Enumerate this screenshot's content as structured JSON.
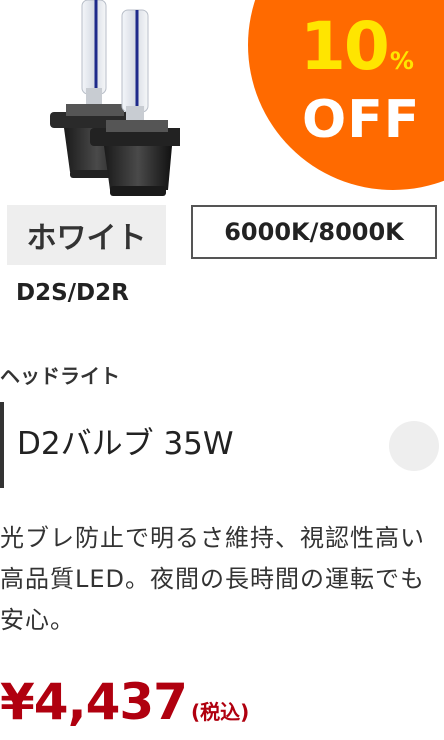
{
  "badge": {
    "number": "10",
    "percent": "%",
    "off": "OFF",
    "bg_color": "#ff6a00",
    "number_color": "#ffe500"
  },
  "product_image": {
    "icon": "hid-bulb-pair-icon"
  },
  "specs": {
    "color_label": "ホワイト",
    "temperature_label": "6000K/8000K",
    "socket_label": "D2S/D2R"
  },
  "product": {
    "category": "ヘッドライト",
    "title": "D2バルブ 35W",
    "description": "光ブレ防止で明るさ維持、視認性高い高品質LED。夜間の長時間の運転でも安心。",
    "price": "¥4,437",
    "tax_note": "(税込)",
    "price_color": "#b0000f"
  },
  "actions": {
    "favorite_icon": "favorite-circle-icon"
  }
}
